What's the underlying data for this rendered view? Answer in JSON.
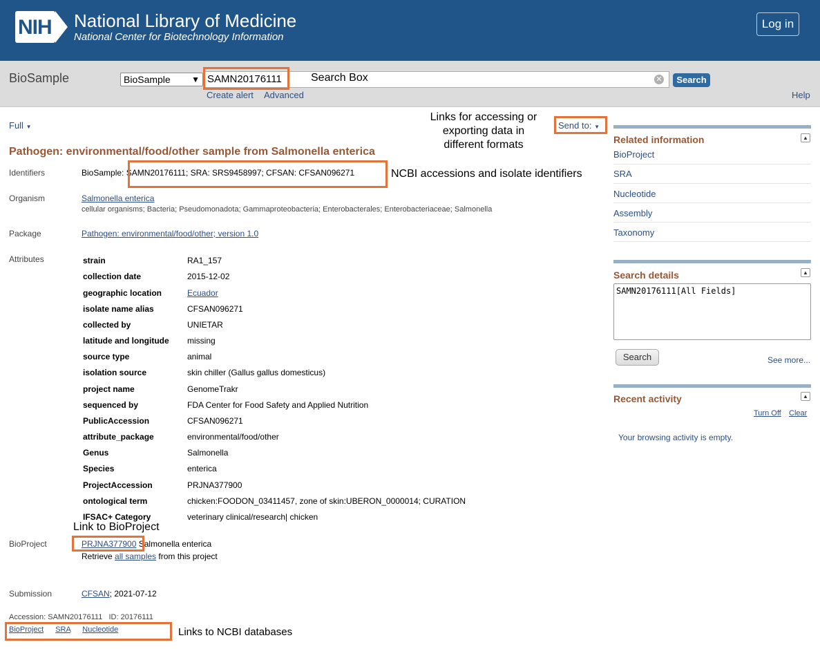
{
  "header": {
    "logo": "NIH",
    "title": "National Library of Medicine",
    "subtitle": "National Center for Biotechnology Information",
    "login_label": "Log in"
  },
  "search": {
    "database_label": "BioSample",
    "database_select": "BioSample",
    "query": "SAMN20176111",
    "search_button": "Search",
    "create_alert": "Create alert",
    "advanced": "Advanced",
    "help": "Help"
  },
  "record": {
    "format": "Full",
    "send_to": "Send to:",
    "title": "Pathogen: environmental/food/other sample from Salmonella enterica",
    "identifiers_label": "Identifiers",
    "identifiers_prefix": "BioSample: ",
    "identifiers_text": "SAMN20176111; SRA: SRS9458997; CFSAN: CFSAN096271",
    "organism_label": "Organism",
    "organism_link": "Salmonella enterica",
    "lineage": "cellular organisms; Bacteria; Pseudomonadota; Gammaproteobacteria; Enterobacterales; Enterobacteriaceae; Salmonella",
    "package_label": "Package",
    "package_link": "Pathogen: environmental/food/other; version 1.0",
    "attributes_label": "Attributes",
    "attributes": [
      {
        "key": "strain",
        "value": "RA1_157"
      },
      {
        "key": "collection date",
        "value": "2015-12-02"
      },
      {
        "key": "geographic location",
        "value": "Ecuador"
      },
      {
        "key": "isolate name alias",
        "value": "CFSAN096271"
      },
      {
        "key": "collected by",
        "value": "UNIETAR"
      },
      {
        "key": "latitude and longitude",
        "value": "missing"
      },
      {
        "key": "source type",
        "value": "animal"
      },
      {
        "key": "isolation source",
        "value": "skin chiller (Gallus gallus domesticus)"
      },
      {
        "key": "project name",
        "value": "GenomeTrakr"
      },
      {
        "key": "sequenced by",
        "value": "FDA Center for Food Safety and Applied Nutrition"
      },
      {
        "key": "PublicAccession",
        "value": "CFSAN096271"
      },
      {
        "key": "attribute_package",
        "value": "environmental/food/other"
      },
      {
        "key": "Genus",
        "value": "Salmonella"
      },
      {
        "key": "Species",
        "value": "enterica"
      },
      {
        "key": "ProjectAccession",
        "value": "PRJNA377900"
      },
      {
        "key": "ontological term",
        "value": "chicken:FOODON_03411457, zone of skin:UBERON_0000014; CURATION"
      },
      {
        "key": "IFSAC+ Category",
        "value": "veterinary clinical/research| chicken"
      }
    ],
    "bioproject_label": "BioProject",
    "bioproject_link": "PRJNA377900",
    "bioproject_org": " Salmonella enterica",
    "retrieve_prefix": "Retrieve ",
    "retrieve_link": "all samples",
    "retrieve_suffix": " from this project",
    "submission_label": "Submission",
    "submission_link": "CFSAN",
    "submission_date": "; 2021-07-12",
    "accession_line": "Accession: SAMN20176111   ID: 20176111",
    "db_links": [
      "BioProject",
      "SRA",
      "Nucleotide"
    ]
  },
  "sidebar": {
    "related_title": "Related information",
    "related_links": [
      "BioProject",
      "SRA",
      "Nucleotide",
      "Assembly",
      "Taxonomy"
    ],
    "details_title": "Search details",
    "details_query": "SAMN20176111[All Fields]",
    "details_button": "Search",
    "see_more": "See more...",
    "recent_title": "Recent activity",
    "turn_off": "Turn Off",
    "clear": "Clear",
    "empty_msg": "Your browsing activity is empty."
  },
  "annotations": {
    "search_box": "Search Box",
    "send_to_note": [
      "Links for accessing or",
      "exporting data in",
      "different formats"
    ],
    "identifiers_note": "NCBI accessions and isolate identifiers",
    "bioproject_note": "Link to BioProject",
    "db_links_note": "Links to NCBI databases",
    "highlight_color": "#e4733a"
  }
}
